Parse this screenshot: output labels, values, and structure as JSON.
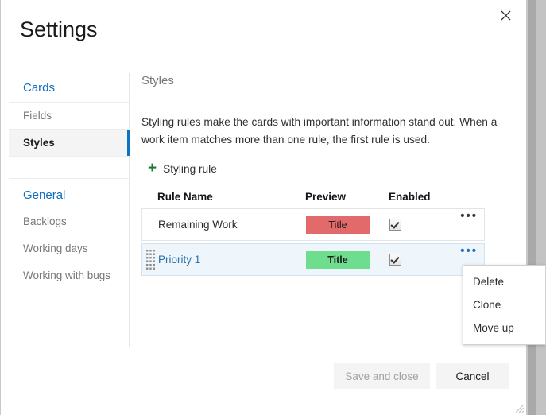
{
  "dialog": {
    "title": "Settings",
    "close_icon": "close-icon"
  },
  "sidebar": {
    "groups": [
      {
        "header": "Cards",
        "items": [
          {
            "label": "Fields",
            "selected": false
          },
          {
            "label": "Styles",
            "selected": true
          }
        ]
      },
      {
        "header": "General",
        "items": [
          {
            "label": "Backlogs",
            "selected": false
          },
          {
            "label": "Working days",
            "selected": false
          },
          {
            "label": "Working with bugs",
            "selected": false
          }
        ]
      }
    ]
  },
  "main": {
    "section_title": "Styles",
    "description": "Styling rules make the cards with important information stand out. When a work item matches more than one rule, the first rule is used.",
    "add_rule": {
      "icon": "plus-icon",
      "label": "Styling rule"
    },
    "table": {
      "columns": {
        "rule_name": "Rule Name",
        "preview": "Preview",
        "enabled": "Enabled"
      },
      "rows": [
        {
          "name": "Remaining Work",
          "preview_label": "Title",
          "preview_color": "#e36a6a",
          "enabled": true,
          "selected": false,
          "menu_glyph": "•••"
        },
        {
          "name": "Priority 1",
          "preview_label": "Title",
          "preview_color": "#6fdd8e",
          "enabled": true,
          "selected": true,
          "menu_glyph": "•••"
        }
      ]
    }
  },
  "context_menu": {
    "items": [
      {
        "label": "Delete"
      },
      {
        "label": "Clone"
      },
      {
        "label": "Move up"
      }
    ]
  },
  "footer": {
    "save_label": "Save and close",
    "cancel_label": "Cancel"
  },
  "colors": {
    "accent": "#0078d4",
    "sidebar_selected_bar": "#0b72c4",
    "add_rule_plus": "#1d7a34",
    "row_selected_bg": "#eef6fc",
    "backdrop": "#c9c9c9"
  }
}
